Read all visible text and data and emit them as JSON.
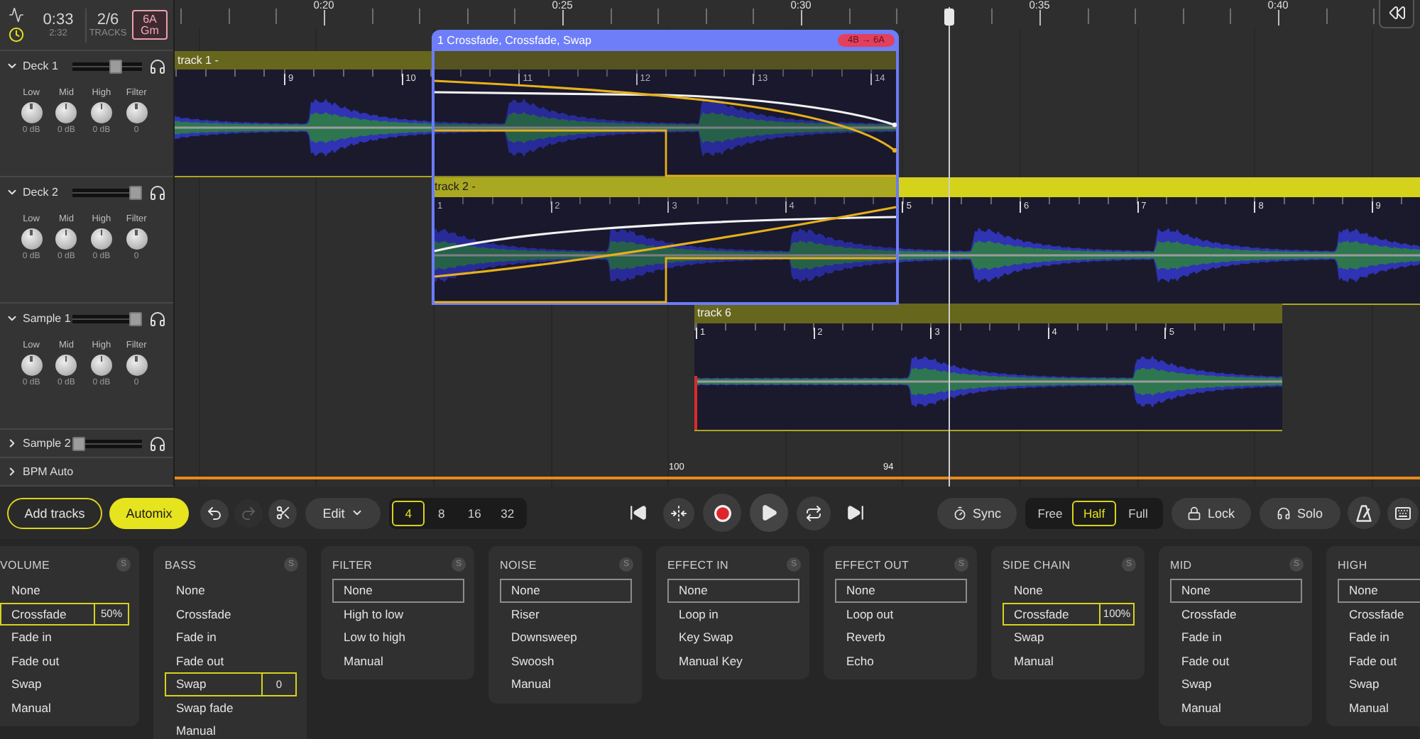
{
  "session": {
    "elapsed": "0:33",
    "duration": "2:32",
    "track_count": "2/6",
    "track_count_label": "TRACKS",
    "key": "6A",
    "key_name": "Gm"
  },
  "decks": [
    {
      "name": "Deck 1",
      "expanded": true,
      "level": 0.65,
      "knobs": [
        {
          "label": "Low",
          "reading": "0 dB"
        },
        {
          "label": "Mid",
          "reading": "0 dB"
        },
        {
          "label": "High",
          "reading": "0 dB"
        },
        {
          "label": "Filter",
          "reading": "0"
        }
      ]
    },
    {
      "name": "Deck 2",
      "expanded": true,
      "level": 1,
      "knobs": [
        {
          "label": "Low",
          "reading": "0 dB"
        },
        {
          "label": "Mid",
          "reading": "0 dB"
        },
        {
          "label": "High",
          "reading": "0 dB"
        },
        {
          "label": "Filter",
          "reading": "0"
        }
      ]
    },
    {
      "name": "Sample 1",
      "expanded": true,
      "level": 1,
      "knobs": [
        {
          "label": "Low",
          "reading": "0 dB"
        },
        {
          "label": "Mid",
          "reading": "0 dB"
        },
        {
          "label": "High",
          "reading": "0 dB"
        },
        {
          "label": "Filter",
          "reading": "0"
        }
      ]
    },
    {
      "name": "Sample 2",
      "expanded": false,
      "level": 0
    }
  ],
  "bpm_auto": {
    "label": "BPM Auto",
    "expanded": false
  },
  "timeline": {
    "ruler": [
      "0:20",
      "0:25",
      "0:30",
      "0:35",
      "0:40"
    ],
    "tracks": [
      {
        "name": "track 1 -",
        "selected": false,
        "beats": [
          "9",
          "10",
          "11",
          "12",
          "13",
          "14"
        ]
      },
      {
        "name": "track 2 -",
        "selected": true,
        "beats": [
          "1",
          "2",
          "3",
          "4",
          "5",
          "6",
          "7",
          "8",
          "9"
        ]
      },
      {
        "name": "track 6",
        "selected": false,
        "beats": [
          "1",
          "2",
          "3",
          "4",
          "5"
        ]
      }
    ],
    "transition": {
      "title": "1 Crossfade, Crossfade, Swap",
      "key_change": "4B → 6A"
    },
    "tempo_points": [
      "100",
      "94"
    ]
  },
  "toolbar": {
    "add_tracks": "Add tracks",
    "automix": "Automix",
    "undo": {
      "disabled": false
    },
    "redo": {
      "disabled": true
    },
    "edit": "Edit",
    "grid": [
      {
        "label": "4",
        "selected": true
      },
      {
        "label": "8",
        "selected": false
      },
      {
        "label": "16",
        "selected": false
      },
      {
        "label": "32",
        "selected": false
      }
    ],
    "sync": "Sync",
    "modes": [
      {
        "label": "Free",
        "selected": false
      },
      {
        "label": "Half",
        "selected": true
      },
      {
        "label": "Full",
        "selected": false
      }
    ],
    "lock": "Lock",
    "solo": "Solo"
  },
  "effect_panels": [
    {
      "title": "VOLUME",
      "solo": "S",
      "options": [
        {
          "label": "None",
          "selected": false
        },
        {
          "label": "Crossfade",
          "selected": true,
          "value": "50%"
        },
        {
          "label": "Fade in",
          "selected": false
        },
        {
          "label": "Fade out",
          "selected": false
        },
        {
          "label": "Swap",
          "selected": false
        },
        {
          "label": "Manual",
          "selected": false
        }
      ]
    },
    {
      "title": "BASS",
      "solo": "S",
      "options": [
        {
          "label": "None",
          "selected": false
        },
        {
          "label": "Crossfade",
          "selected": false
        },
        {
          "label": "Fade in",
          "selected": false
        },
        {
          "label": "Fade out",
          "selected": false
        },
        {
          "label": "Swap",
          "selected": true,
          "value": "0"
        },
        {
          "label": "Swap fade",
          "selected": false
        },
        {
          "label": "Manual",
          "selected": false
        }
      ]
    },
    {
      "title": "FILTER",
      "solo": "S",
      "options": [
        {
          "label": "None",
          "selected": true
        },
        {
          "label": "High to low",
          "selected": false
        },
        {
          "label": "Low to high",
          "selected": false
        },
        {
          "label": "Manual",
          "selected": false
        }
      ]
    },
    {
      "title": "NOISE",
      "solo": "S",
      "options": [
        {
          "label": "None",
          "selected": true
        },
        {
          "label": "Riser",
          "selected": false
        },
        {
          "label": "Downsweep",
          "selected": false
        },
        {
          "label": "Swoosh",
          "selected": false
        },
        {
          "label": "Manual",
          "selected": false
        }
      ]
    },
    {
      "title": "EFFECT IN",
      "solo": "S",
      "options": [
        {
          "label": "None",
          "selected": true
        },
        {
          "label": "Loop in",
          "selected": false
        },
        {
          "label": "Key Swap",
          "selected": false
        },
        {
          "label": "Manual Key",
          "selected": false
        }
      ]
    },
    {
      "title": "EFFECT OUT",
      "solo": "S",
      "options": [
        {
          "label": "None",
          "selected": true
        },
        {
          "label": "Loop out",
          "selected": false
        },
        {
          "label": "Reverb",
          "selected": false
        },
        {
          "label": "Echo",
          "selected": false
        }
      ]
    },
    {
      "title": "SIDE CHAIN",
      "solo": "S",
      "options": [
        {
          "label": "None",
          "selected": false
        },
        {
          "label": "Crossfade",
          "selected": true,
          "value": "100%"
        },
        {
          "label": "Swap",
          "selected": false
        },
        {
          "label": "Manual",
          "selected": false
        }
      ]
    },
    {
      "title": "MID",
      "solo": "S",
      "options": [
        {
          "label": "None",
          "selected": true
        },
        {
          "label": "Crossfade",
          "selected": false
        },
        {
          "label": "Fade in",
          "selected": false
        },
        {
          "label": "Fade out",
          "selected": false
        },
        {
          "label": "Swap",
          "selected": false
        },
        {
          "label": "Manual",
          "selected": false
        }
      ]
    },
    {
      "title": "HIGH",
      "options": [
        {
          "label": "None",
          "selected": true
        },
        {
          "label": "Crossfade",
          "selected": false
        },
        {
          "label": "Fade in",
          "selected": false
        },
        {
          "label": "Fade out",
          "selected": false
        },
        {
          "label": "Swap",
          "selected": false
        },
        {
          "label": "Manual",
          "selected": false
        }
      ]
    }
  ]
}
